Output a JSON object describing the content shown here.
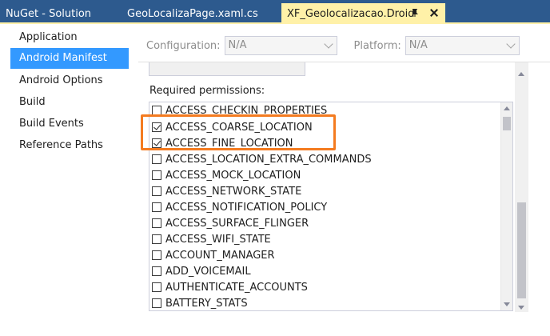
{
  "tabs": [
    {
      "label": "NuGet - Solution",
      "active": false
    },
    {
      "label": "GeoLocalizaPage.xaml.cs",
      "active": false
    },
    {
      "label": "XF_Geolocalizacao.Droid",
      "active": true
    }
  ],
  "sidebar": {
    "items": [
      {
        "label": "Application",
        "selected": false
      },
      {
        "label": "Android Manifest",
        "selected": true
      },
      {
        "label": "Android Options",
        "selected": false
      },
      {
        "label": "Build",
        "selected": false
      },
      {
        "label": "Build Events",
        "selected": false
      },
      {
        "label": "Reference Paths",
        "selected": false
      }
    ]
  },
  "config": {
    "configuration_label": "Configuration:",
    "configuration_value": "N/A",
    "platform_label": "Platform:",
    "platform_value": "N/A"
  },
  "permissions": {
    "label": "Required permissions:",
    "items": [
      {
        "name": "ACCESS_CHECKIN_PROPERTIES",
        "checked": false
      },
      {
        "name": "ACCESS_COARSE_LOCATION",
        "checked": true
      },
      {
        "name": "ACCESS_FINE_LOCATION",
        "checked": true
      },
      {
        "name": "ACCESS_LOCATION_EXTRA_COMMANDS",
        "checked": false
      },
      {
        "name": "ACCESS_MOCK_LOCATION",
        "checked": false
      },
      {
        "name": "ACCESS_NETWORK_STATE",
        "checked": false
      },
      {
        "name": "ACCESS_NOTIFICATION_POLICY",
        "checked": false
      },
      {
        "name": "ACCESS_SURFACE_FLINGER",
        "checked": false
      },
      {
        "name": "ACCESS_WIFI_STATE",
        "checked": false
      },
      {
        "name": "ACCOUNT_MANAGER",
        "checked": false
      },
      {
        "name": "ADD_VOICEMAIL",
        "checked": false
      },
      {
        "name": "AUTHENTICATE_ACCOUNTS",
        "checked": false
      },
      {
        "name": "BATTERY_STATS",
        "checked": false
      }
    ]
  },
  "colors": {
    "tab_bar": "#2d5a8e",
    "active_tab": "#fff1a8",
    "selection": "#3399ff",
    "highlight": "#f47b20"
  },
  "icons": {
    "tab_pin": "pin-icon",
    "tab_close": "close-icon"
  }
}
